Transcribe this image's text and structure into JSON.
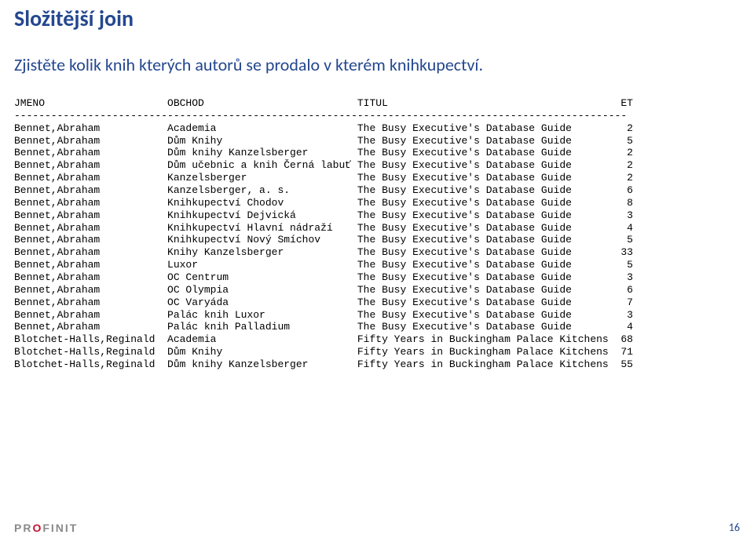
{
  "title": "Složitější join",
  "subtitle": "Zjistěte kolik knih kterých autorů se prodalo v kterém knihkupectví.",
  "header": {
    "jmeno": "JMENO",
    "obchod": "OBCHOD",
    "titul": "TITUL",
    "et": "ET"
  },
  "separator": "----------------------------------------------------------------------------------------------------",
  "rows": [
    {
      "jmeno": "Bennet,Abraham",
      "obchod": "Academia",
      "titul": "The Busy Executive's Database Guide",
      "et": "2"
    },
    {
      "jmeno": "Bennet,Abraham",
      "obchod": "Dům Knihy",
      "titul": "The Busy Executive's Database Guide",
      "et": "5"
    },
    {
      "jmeno": "Bennet,Abraham",
      "obchod": "Dům knihy Kanzelsberger",
      "titul": "The Busy Executive's Database Guide",
      "et": "2"
    },
    {
      "jmeno": "Bennet,Abraham",
      "obchod": "Dům učebnic a knih Černá labuť",
      "titul": "The Busy Executive's Database Guide",
      "et": "2"
    },
    {
      "jmeno": "Bennet,Abraham",
      "obchod": "Kanzelsberger",
      "titul": "The Busy Executive's Database Guide",
      "et": "2"
    },
    {
      "jmeno": "Bennet,Abraham",
      "obchod": "Kanzelsberger, a. s.",
      "titul": "The Busy Executive's Database Guide",
      "et": "6"
    },
    {
      "jmeno": "Bennet,Abraham",
      "obchod": "Knihkupectví Chodov",
      "titul": "The Busy Executive's Database Guide",
      "et": "8"
    },
    {
      "jmeno": "Bennet,Abraham",
      "obchod": "Knihkupectví Dejvická",
      "titul": "The Busy Executive's Database Guide",
      "et": "3"
    },
    {
      "jmeno": "Bennet,Abraham",
      "obchod": "Knihkupectví Hlavní nádraží",
      "titul": "The Busy Executive's Database Guide",
      "et": "4"
    },
    {
      "jmeno": "Bennet,Abraham",
      "obchod": "Knihkupectví Nový Smíchov",
      "titul": "The Busy Executive's Database Guide",
      "et": "5"
    },
    {
      "jmeno": "Bennet,Abraham",
      "obchod": "Knihy Kanzelsberger",
      "titul": "The Busy Executive's Database Guide",
      "et": "33"
    },
    {
      "jmeno": "Bennet,Abraham",
      "obchod": "Luxor",
      "titul": "The Busy Executive's Database Guide",
      "et": "5"
    },
    {
      "jmeno": "Bennet,Abraham",
      "obchod": "OC Centrum",
      "titul": "The Busy Executive's Database Guide",
      "et": "3"
    },
    {
      "jmeno": "Bennet,Abraham",
      "obchod": "OC Olympia",
      "titul": "The Busy Executive's Database Guide",
      "et": "6"
    },
    {
      "jmeno": "Bennet,Abraham",
      "obchod": "OC Varyáda",
      "titul": "The Busy Executive's Database Guide",
      "et": "7"
    },
    {
      "jmeno": "Bennet,Abraham",
      "obchod": "Palác knih Luxor",
      "titul": "The Busy Executive's Database Guide",
      "et": "3"
    },
    {
      "jmeno": "Bennet,Abraham",
      "obchod": "Palác knih Palladium",
      "titul": "The Busy Executive's Database Guide",
      "et": "4"
    },
    {
      "jmeno": "Blotchet-Halls,Reginald",
      "obchod": "Academia",
      "titul": "Fifty Years in Buckingham Palace Kitchens",
      "et": "68"
    },
    {
      "jmeno": "Blotchet-Halls,Reginald",
      "obchod": "Dům Knihy",
      "titul": "Fifty Years in Buckingham Palace Kitchens",
      "et": "71"
    },
    {
      "jmeno": "Blotchet-Halls,Reginald",
      "obchod": "Dům knihy Kanzelsberger",
      "titul": "Fifty Years in Buckingham Palace Kitchens",
      "et": "55"
    }
  ],
  "brand": {
    "pre": "PR",
    "accent": "O",
    "post": "FINIT"
  },
  "page_number": "16"
}
